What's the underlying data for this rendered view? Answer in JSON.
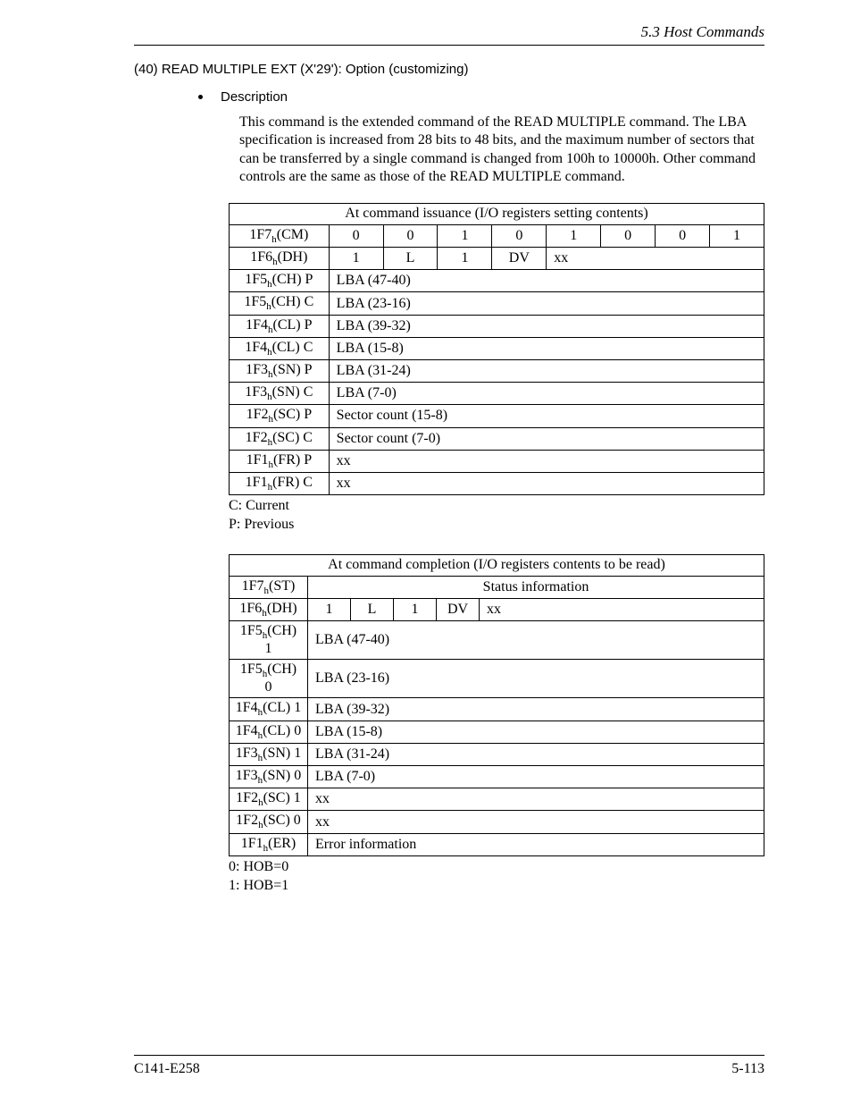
{
  "header": {
    "text": "5.3  Host Commands"
  },
  "section": {
    "title": "(40)  READ MULTIPLE EXT (X'29'):  Option (customizing)"
  },
  "desc_label": "Description",
  "desc_body": "This command is the extended command of the READ MULTIPLE command. The LBA specification is increased from 28 bits to 48 bits, and the maximum number of sectors that can be transferred by a single command is changed from 100h to 10000h.  Other command controls are the same as those of the READ MULTIPLE command.",
  "table1": {
    "title": "At command issuance (I/O registers setting contents)",
    "rows": [
      {
        "label_prefix": "1F7",
        "label_sub": "h",
        "label_suffix": "(CM)",
        "cells": [
          "0",
          "0",
          "1",
          "0",
          "1",
          "0",
          "0",
          "1"
        ]
      },
      {
        "label_prefix": "1F6",
        "label_sub": "h",
        "label_suffix": "(DH)",
        "cells": [
          "1",
          "L",
          "1",
          "DV",
          "xx",
          "",
          "",
          ""
        ],
        "merge_from": 4
      },
      {
        "label_prefix": "1F5",
        "label_sub": "h",
        "label_suffix": "(CH) P",
        "wide": "LBA (47-40)"
      },
      {
        "label_prefix": "1F5",
        "label_sub": "h",
        "label_suffix": "(CH) C",
        "wide": "LBA (23-16)"
      },
      {
        "label_prefix": "1F4",
        "label_sub": "h",
        "label_suffix": "(CL) P",
        "wide": "LBA (39-32)"
      },
      {
        "label_prefix": "1F4",
        "label_sub": "h",
        "label_suffix": "(CL) C",
        "wide": "LBA (15-8)"
      },
      {
        "label_prefix": "1F3",
        "label_sub": "h",
        "label_suffix": "(SN) P",
        "wide": "LBA (31-24)"
      },
      {
        "label_prefix": "1F3",
        "label_sub": "h",
        "label_suffix": "(SN) C",
        "wide": "LBA (7-0)"
      },
      {
        "label_prefix": "1F2",
        "label_sub": "h",
        "label_suffix": "(SC) P",
        "wide": "Sector count (15-8)"
      },
      {
        "label_prefix": "1F2",
        "label_sub": "h",
        "label_suffix": "(SC) C",
        "wide": "Sector count (7-0)"
      },
      {
        "label_prefix": "1F1",
        "label_sub": "h",
        "label_suffix": "(FR) P",
        "wide": "xx"
      },
      {
        "label_prefix": "1F1",
        "label_sub": "h",
        "label_suffix": "(FR) C",
        "wide": "xx"
      }
    ],
    "legend1": "C:  Current",
    "legend2": "P:  Previous"
  },
  "table2": {
    "title": "At command completion (I/O registers contents to be read)",
    "rows": [
      {
        "label_prefix": "1F7",
        "label_sub": "h",
        "label_suffix": "(ST)",
        "wide": "Status information",
        "center": true
      },
      {
        "label_prefix": "1F6",
        "label_sub": "h",
        "label_suffix": "(DH)",
        "cells": [
          "1",
          "L",
          "1",
          "DV",
          "xx",
          "",
          "",
          ""
        ],
        "merge_from": 4
      },
      {
        "label_prefix": "1F5",
        "label_sub": "h",
        "label_suffix": "(CH) 1",
        "wide": "LBA (47-40)"
      },
      {
        "label_prefix": "1F5",
        "label_sub": "h",
        "label_suffix": "(CH) 0",
        "wide": "LBA (23-16)"
      },
      {
        "label_prefix": "1F4",
        "label_sub": "h",
        "label_suffix": "(CL) 1",
        "wide": "LBA (39-32)"
      },
      {
        "label_prefix": "1F4",
        "label_sub": "h",
        "label_suffix": "(CL) 0",
        "wide": "LBA (15-8)"
      },
      {
        "label_prefix": "1F3",
        "label_sub": "h",
        "label_suffix": "(SN) 1",
        "wide": "LBA (31-24)"
      },
      {
        "label_prefix": "1F3",
        "label_sub": "h",
        "label_suffix": "(SN) 0",
        "wide": "LBA (7-0)"
      },
      {
        "label_prefix": "1F2",
        "label_sub": "h",
        "label_suffix": "(SC) 1",
        "wide": "xx"
      },
      {
        "label_prefix": "1F2",
        "label_sub": "h",
        "label_suffix": "(SC) 0",
        "wide": "xx"
      },
      {
        "label_prefix": "1F1",
        "label_sub": "h",
        "label_suffix": "(ER)",
        "wide": "Error information"
      }
    ],
    "legend1": "0:  HOB=0",
    "legend2": "1:  HOB=1"
  },
  "footer": {
    "left": "C141-E258",
    "right": "5-113"
  }
}
